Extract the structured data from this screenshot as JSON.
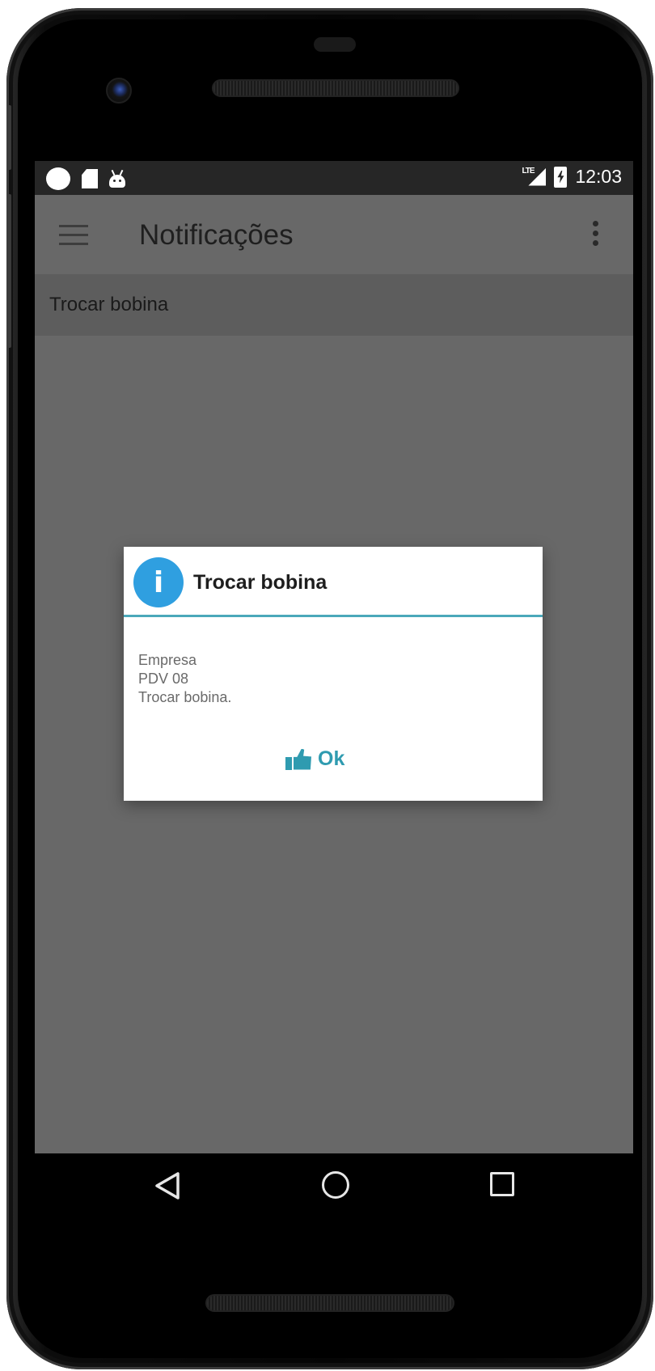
{
  "status_bar": {
    "time": "12:03",
    "network": "LTE",
    "icons": [
      "notification-circle-icon",
      "sd-card-icon",
      "android-debug-icon",
      "lte-signal-icon",
      "battery-charging-icon"
    ]
  },
  "app_bar": {
    "title": "Notificações",
    "menu_icon": "hamburger-menu-icon",
    "overflow_icon": "more-vert-icon"
  },
  "list": {
    "items": [
      {
        "label": "Trocar bobina"
      }
    ]
  },
  "dialog": {
    "icon": "info-icon",
    "icon_glyph": "i",
    "title": "Trocar bobina",
    "body_lines": [
      "Empresa",
      "PDV 08",
      "Trocar bobina."
    ],
    "ok_icon": "thumbs-up-icon",
    "ok_label": "Ok",
    "accent_color": "#2f9bb0",
    "info_color": "#2f9fe0"
  },
  "nav_bar": {
    "back_icon": "back-triangle-icon",
    "home_icon": "home-circle-icon",
    "recents_icon": "recents-square-icon"
  }
}
